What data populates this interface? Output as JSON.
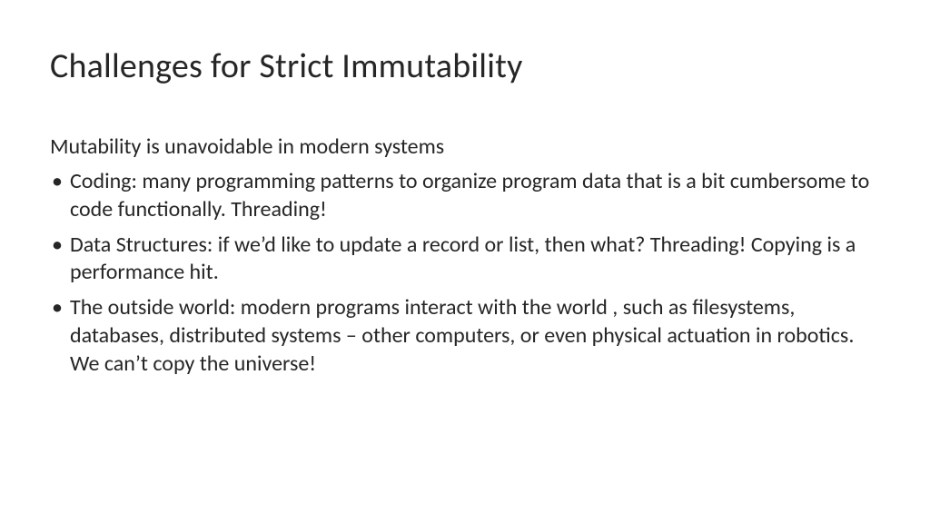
{
  "slide": {
    "title": "Challenges for Strict Immutability",
    "lead": "Mutability is unavoidable in modern systems",
    "bullets": [
      "Coding: many programming patterns to organize program data that is a bit cumbersome to code functionally. Threading!",
      "Data Structures: if we’d like to update a record or list, then what? Threading! Copying is a performance hit.",
      "The outside world: modern programs interact with the world , such as filesystems, databases, distributed systems – other computers, or even physical actuation in robotics. We can’t copy the universe!"
    ]
  }
}
